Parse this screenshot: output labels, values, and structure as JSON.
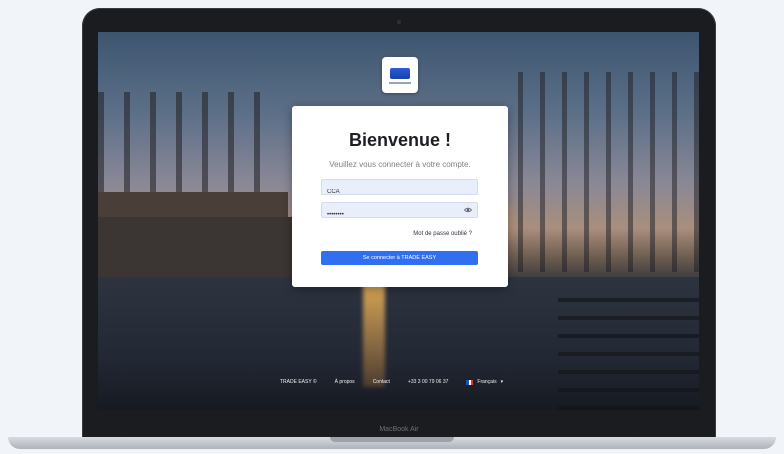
{
  "login": {
    "title": "Bienvenue !",
    "subtitle": "Veuillez vous connecter à votre compte.",
    "username_value": "CCA",
    "password_value": "••••••••",
    "forgot_link": "Mot de passe oublié ?",
    "submit_label": "Se connecter à TRADE EASY"
  },
  "footer": {
    "brand": "TRADE EASY ©",
    "about": "À propos",
    "contact": "Contact",
    "phone": "+33 3 00 79 06 37",
    "language": "Français",
    "caret": "▾"
  },
  "device": {
    "label": "MacBook Air"
  },
  "colors": {
    "accent": "#2f6ff0",
    "field_bg": "#e9eefb",
    "card_bg": "#ffffff"
  },
  "icons": {
    "password_toggle": "eye-icon",
    "language_flag": "france-flag-icon",
    "logo": "trade-easy-logo"
  }
}
